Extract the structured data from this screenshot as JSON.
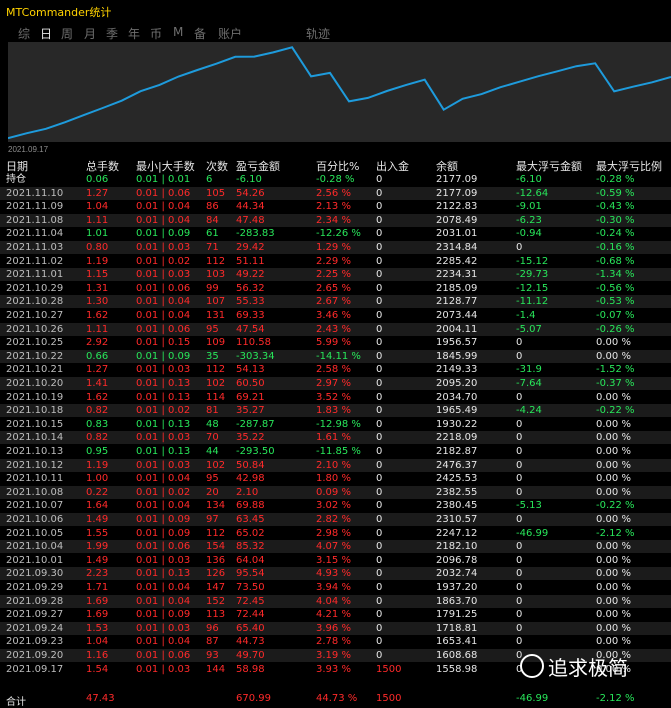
{
  "window": {
    "title": "MTCommander统计"
  },
  "tabs": [
    {
      "label": "综",
      "active": false
    },
    {
      "label": "日",
      "active": true
    },
    {
      "label": "周",
      "active": false
    },
    {
      "label": "月",
      "active": false
    },
    {
      "label": "季",
      "active": false
    },
    {
      "label": "年",
      "active": false
    },
    {
      "label": "币",
      "active": false
    },
    {
      "label": "M",
      "active": false
    },
    {
      "label": "备",
      "active": false
    },
    {
      "label": "账户",
      "active": false
    },
    {
      "label": "轨迹",
      "active": false
    }
  ],
  "chart_data": {
    "type": "line",
    "title": "",
    "xlabel": "",
    "ylabel": "",
    "x_start_label": "2021.09.17",
    "grid": false,
    "line_color": "#1e9bdc",
    "x": [
      "2021.09.17",
      "2021.09.20",
      "2021.09.23",
      "2021.09.24",
      "2021.09.27",
      "2021.09.28",
      "2021.09.29",
      "2021.09.30",
      "2021.10.01",
      "2021.10.04",
      "2021.10.05",
      "2021.10.06",
      "2021.10.07",
      "2021.10.08",
      "2021.10.11",
      "2021.10.12",
      "2021.10.13",
      "2021.10.14",
      "2021.10.15",
      "2021.10.18",
      "2021.10.19",
      "2021.10.20",
      "2021.10.21",
      "2021.10.22",
      "2021.10.25",
      "2021.10.26",
      "2021.10.27",
      "2021.10.28",
      "2021.10.29",
      "2021.11.01",
      "2021.11.02",
      "2021.11.03",
      "2021.11.04",
      "2021.11.08",
      "2021.11.09",
      "2021.11.10"
    ],
    "values": [
      1558.98,
      1608.68,
      1653.41,
      1718.81,
      1791.25,
      1863.7,
      1937.2,
      2032.74,
      2096.78,
      2182.1,
      2247.12,
      2310.57,
      2380.45,
      2382.55,
      2425.53,
      2476.37,
      2182.87,
      2218.09,
      1930.22,
      1965.49,
      2034.7,
      2095.2,
      2149.33,
      1845.99,
      1956.57,
      2004.11,
      2073.44,
      2128.77,
      2185.09,
      2234.31,
      2285.42,
      2314.84,
      2031.01,
      2078.49,
      2122.83,
      2177.09
    ],
    "ylim": [
      1540,
      2500
    ]
  },
  "table": {
    "headers": [
      "日期",
      "总手数",
      "最小|大手数",
      "次数",
      "盈亏金额",
      "百分比%",
      "出入金",
      "余额",
      "最大浮亏金额",
      "最大浮亏比例"
    ],
    "rows": [
      [
        "持仓",
        "0.06",
        "0.01 | 0.01",
        "6",
        "-6.10",
        "-0.28 %",
        "0",
        "2177.09",
        "-6.10",
        "-0.28 %"
      ],
      [
        "2021.11.10",
        "1.27",
        "0.01 | 0.06",
        "105",
        "54.26",
        "2.56 %",
        "0",
        "2177.09",
        "-12.64",
        "-0.59 %"
      ],
      [
        "2021.11.09",
        "1.04",
        "0.01 | 0.04",
        "86",
        "44.34",
        "2.13 %",
        "0",
        "2122.83",
        "-9.01",
        "-0.43 %"
      ],
      [
        "2021.11.08",
        "1.11",
        "0.01 | 0.04",
        "84",
        "47.48",
        "2.34 %",
        "0",
        "2078.49",
        "-6.23",
        "-0.30 %"
      ],
      [
        "2021.11.04",
        "1.01",
        "0.01 | 0.09",
        "61",
        "-283.83",
        "-12.26 %",
        "0",
        "2031.01",
        "-0.94",
        "-0.24 %"
      ],
      [
        "2021.11.03",
        "0.80",
        "0.01 | 0.03",
        "71",
        "29.42",
        "1.29 %",
        "0",
        "2314.84",
        "0",
        "-0.16 %"
      ],
      [
        "2021.11.02",
        "1.19",
        "0.01 | 0.02",
        "112",
        "51.11",
        "2.29 %",
        "0",
        "2285.42",
        "-15.12",
        "-0.68 %"
      ],
      [
        "2021.11.01",
        "1.15",
        "0.01 | 0.03",
        "103",
        "49.22",
        "2.25 %",
        "0",
        "2234.31",
        "-29.73",
        "-1.34 %"
      ],
      [
        "2021.10.29",
        "1.31",
        "0.01 | 0.06",
        "99",
        "56.32",
        "2.65 %",
        "0",
        "2185.09",
        "-12.15",
        "-0.56 %"
      ],
      [
        "2021.10.28",
        "1.30",
        "0.01 | 0.04",
        "107",
        "55.33",
        "2.67 %",
        "0",
        "2128.77",
        "-11.12",
        "-0.53 %"
      ],
      [
        "2021.10.27",
        "1.62",
        "0.01 | 0.04",
        "131",
        "69.33",
        "3.46 %",
        "0",
        "2073.44",
        "-1.4",
        "-0.07 %"
      ],
      [
        "2021.10.26",
        "1.11",
        "0.01 | 0.06",
        "95",
        "47.54",
        "2.43 %",
        "0",
        "2004.11",
        "-5.07",
        "-0.26 %"
      ],
      [
        "2021.10.25",
        "2.92",
        "0.01 | 0.15",
        "109",
        "110.58",
        "5.99 %",
        "0",
        "1956.57",
        "0",
        "0.00 %"
      ],
      [
        "2021.10.22",
        "0.66",
        "0.01 | 0.09",
        "35",
        "-303.34",
        "-14.11 %",
        "0",
        "1845.99",
        "0",
        "0.00 %"
      ],
      [
        "2021.10.21",
        "1.27",
        "0.01 | 0.03",
        "112",
        "54.13",
        "2.58 %",
        "0",
        "2149.33",
        "-31.9",
        "-1.52 %"
      ],
      [
        "2021.10.20",
        "1.41",
        "0.01 | 0.13",
        "102",
        "60.50",
        "2.97 %",
        "0",
        "2095.20",
        "-7.64",
        "-0.37 %"
      ],
      [
        "2021.10.19",
        "1.62",
        "0.01 | 0.13",
        "114",
        "69.21",
        "3.52 %",
        "0",
        "2034.70",
        "0",
        "0.00 %"
      ],
      [
        "2021.10.18",
        "0.82",
        "0.01 | 0.02",
        "81",
        "35.27",
        "1.83 %",
        "0",
        "1965.49",
        "-4.24",
        "-0.22 %"
      ],
      [
        "2021.10.15",
        "0.83",
        "0.01 | 0.13",
        "48",
        "-287.87",
        "-12.98 %",
        "0",
        "1930.22",
        "0",
        "0.00 %"
      ],
      [
        "2021.10.14",
        "0.82",
        "0.01 | 0.03",
        "70",
        "35.22",
        "1.61 %",
        "0",
        "2218.09",
        "0",
        "0.00 %"
      ],
      [
        "2021.10.13",
        "0.95",
        "0.01 | 0.13",
        "44",
        "-293.50",
        "-11.85 %",
        "0",
        "2182.87",
        "0",
        "0.00 %"
      ],
      [
        "2021.10.12",
        "1.19",
        "0.01 | 0.03",
        "102",
        "50.84",
        "2.10 %",
        "0",
        "2476.37",
        "0",
        "0.00 %"
      ],
      [
        "2021.10.11",
        "1.00",
        "0.01 | 0.04",
        "95",
        "42.98",
        "1.80 %",
        "0",
        "2425.53",
        "0",
        "0.00 %"
      ],
      [
        "2021.10.08",
        "0.22",
        "0.01 | 0.02",
        "20",
        "2.10",
        "0.09 %",
        "0",
        "2382.55",
        "0",
        "0.00 %"
      ],
      [
        "2021.10.07",
        "1.64",
        "0.01 | 0.04",
        "134",
        "69.88",
        "3.02 %",
        "0",
        "2380.45",
        "-5.13",
        "-0.22 %"
      ],
      [
        "2021.10.06",
        "1.49",
        "0.01 | 0.09",
        "97",
        "63.45",
        "2.82 %",
        "0",
        "2310.57",
        "0",
        "0.00 %"
      ],
      [
        "2021.10.05",
        "1.55",
        "0.01 | 0.09",
        "112",
        "65.02",
        "2.98 %",
        "0",
        "2247.12",
        "-46.99",
        "-2.12 %"
      ],
      [
        "2021.10.04",
        "1.99",
        "0.01 | 0.06",
        "154",
        "85.32",
        "4.07 %",
        "0",
        "2182.10",
        "0",
        "0.00 %"
      ],
      [
        "2021.10.01",
        "1.49",
        "0.01 | 0.03",
        "136",
        "64.04",
        "3.15 %",
        "0",
        "2096.78",
        "0",
        "0.00 %"
      ],
      [
        "2021.09.30",
        "2.23",
        "0.01 | 0.13",
        "126",
        "95.54",
        "4.93 %",
        "0",
        "2032.74",
        "0",
        "0.00 %"
      ],
      [
        "2021.09.29",
        "1.71",
        "0.01 | 0.04",
        "147",
        "73.50",
        "3.94 %",
        "0",
        "1937.20",
        "0",
        "0.00 %"
      ],
      [
        "2021.09.28",
        "1.69",
        "0.01 | 0.04",
        "152",
        "72.45",
        "4.04 %",
        "0",
        "1863.70",
        "0",
        "0.00 %"
      ],
      [
        "2021.09.27",
        "1.69",
        "0.01 | 0.09",
        "113",
        "72.44",
        "4.21 %",
        "0",
        "1791.25",
        "0",
        "0.00 %"
      ],
      [
        "2021.09.24",
        "1.53",
        "0.01 | 0.03",
        "96",
        "65.40",
        "3.96 %",
        "0",
        "1718.81",
        "0",
        "0.00 %"
      ],
      [
        "2021.09.23",
        "1.04",
        "0.01 | 0.04",
        "87",
        "44.73",
        "2.78 %",
        "0",
        "1653.41",
        "0",
        "0.00 %"
      ],
      [
        "2021.09.20",
        "1.16",
        "0.01 | 0.06",
        "93",
        "49.70",
        "3.19 %",
        "0",
        "1608.68",
        "0",
        "0.00 %"
      ],
      [
        "2021.09.17",
        "1.54",
        "0.01 | 0.03",
        "144",
        "58.98",
        "3.93 %",
        "1500",
        "1558.98",
        "0",
        "0.00 %"
      ]
    ],
    "total": [
      "合计",
      "47.43",
      "",
      "",
      "670.99",
      "44.73 %",
      "1500",
      "",
      "-46.99",
      "-2.12 %"
    ]
  },
  "colors": {
    "background": "#000000",
    "title": "#ffd200",
    "text": "#e6e6e6",
    "positive": "#ff2a2a",
    "negative": "#28e65a",
    "date": "#bdbdbd",
    "row_alt": "#1b1b1b",
    "chart_bg": "#282828",
    "chart_line": "#1e9bdc"
  },
  "watermark": {
    "text": "追求极简"
  }
}
